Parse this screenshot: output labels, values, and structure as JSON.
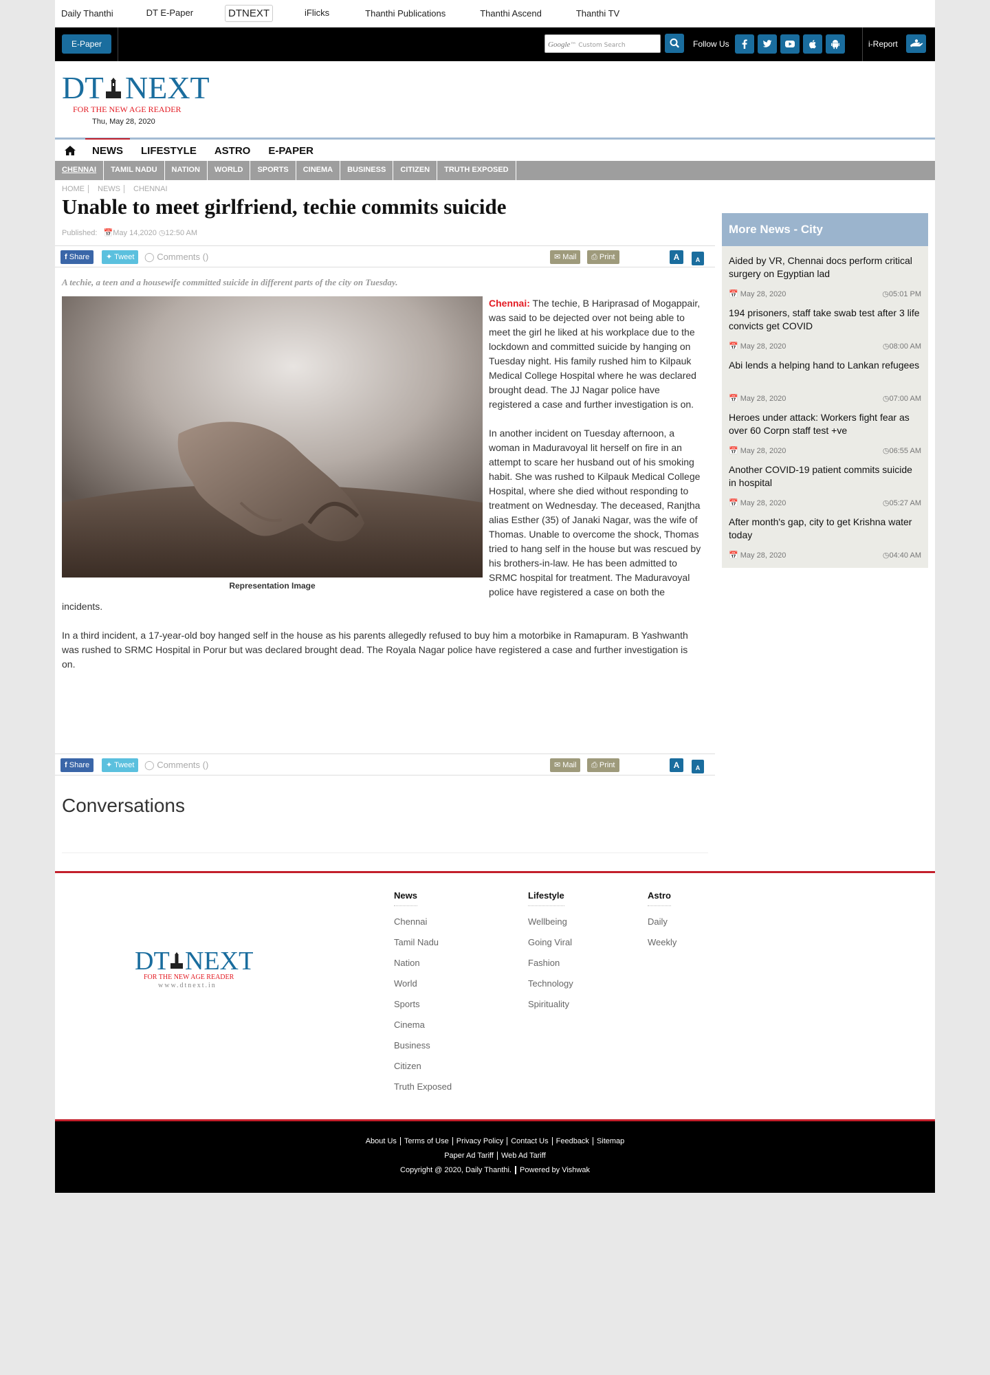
{
  "network": [
    "Daily Thanthi",
    "DT E-Paper",
    "DTNEXT",
    "iFlicks",
    "Thanthi Publications",
    "Thanthi Ascend",
    "Thanthi TV"
  ],
  "blackbar": {
    "epaper_label": "E-Paper",
    "search_placeholder": "Custom Search",
    "search_brand": "Google",
    "follow_label": "Follow Us",
    "ireport_label": "i-Report"
  },
  "masthead": {
    "logo_text": "DT NEXT",
    "tagline": "FOR THE NEW AGE READER",
    "date": "Thu, May 28, 2020"
  },
  "mainnav": [
    "NEWS",
    "LIFESTYLE",
    "ASTRO",
    "E-PAPER"
  ],
  "subnav": [
    "CHENNAI",
    "TAMIL NADU",
    "NATION",
    "WORLD",
    "SPORTS",
    "CINEMA",
    "BUSINESS",
    "CITIZEN",
    "TRUTH EXPOSED"
  ],
  "breadcrumb": [
    "HOME",
    "NEWS",
    "CHENNAI"
  ],
  "article": {
    "title": "Unable to meet girlfriend, techie commits suicide",
    "published_label": "Published:",
    "date": "May 14,2020",
    "time": "12:50 AM",
    "summary": "A techie, a teen and a housewife committed suicide in different parts of the city on Tuesday.",
    "caption": "Representation Image",
    "location": "Chennai:",
    "p1": "The techie, B Hariprasad of Mogappair, was said to be dejected over not being able to meet the girl he liked at his workplace due to the lockdown and committed suicide by hanging on Tuesday night. His family rushed him to Kilpauk Medical College Hospital where he was declared brought dead. The JJ Nagar police have registered a case and further investigation is on.",
    "p2": "In another incident on Tuesday afternoon, a woman in Maduravoyal lit herself on fire in an attempt to scare her husband out of his smoking habit. She was rushed to Kilpauk Medical College Hospital, where she died without responding to treatment on Wednesday. The deceased, Ranjtha alias Esther (35) of Janaki Nagar, was the wife of Thomas. Unable to overcome the shock, Thomas tried to hang self in the house but was rescued by his brothers-in-law. He has been admitted to SRMC hospital for treatment. The Maduravoyal police have registered a case on both the incidents.",
    "p3": "In a third incident, a 17-year-old boy hanged self in the house as his parents allegedly refused to buy him a motorbike in Ramapuram. B Yashwanth was rushed to SRMC Hospital in Porur but was declared brought dead. The Royala Nagar police have registered a case and further investigation is on."
  },
  "sharebar": {
    "share": "Share",
    "tweet": "Tweet",
    "comments": "Comments ()",
    "mail": "Mail",
    "print": "Print",
    "font_large": "A",
    "font_small": "A"
  },
  "conversations": "Conversations",
  "sidebar": {
    "title": "More News - City",
    "items": [
      {
        "headline": "Aided by VR, Chennai docs perform critical surgery on Egyptian lad",
        "date": "May 28, 2020",
        "time": "05:01 PM"
      },
      {
        "headline": "194 prisoners, staff take swab test after 3 life convicts get COVID",
        "date": "May 28, 2020",
        "time": "08:00 AM"
      },
      {
        "headline": "Abi lends a helping hand to Lankan refugees",
        "date": "May 28, 2020",
        "time": "07:00 AM"
      },
      {
        "headline": "Heroes under attack: Workers fight fear as over 60 Corpn staff test +ve",
        "date": "May 28, 2020",
        "time": "06:55 AM"
      },
      {
        "headline": "Another COVID-19 patient commits suicide in hospital",
        "date": "May 28, 2020",
        "time": "05:27 AM"
      },
      {
        "headline": "After month's gap, city to get Krishna water today",
        "date": "May 28, 2020",
        "time": "04:40 AM"
      }
    ]
  },
  "footer": {
    "logo_url_text": "www.dtnext.in",
    "news_head": "News",
    "news": [
      "Chennai",
      "Tamil Nadu",
      "Nation",
      "World",
      "Sports",
      "Cinema",
      "Business",
      "Citizen",
      "Truth Exposed"
    ],
    "lifestyle_head": "Lifestyle",
    "lifestyle": [
      "Wellbeing",
      "Going Viral",
      "Fashion",
      "Technology",
      "Spirituality"
    ],
    "astro_head": "Astro",
    "astro": [
      "Daily",
      "Weekly"
    ],
    "links1": [
      "About Us",
      "Terms of Use",
      "Privacy Policy",
      "Contact Us",
      "Feedback",
      "Sitemap"
    ],
    "links2": [
      "Paper Ad Tariff",
      "Web Ad Tariff"
    ],
    "copyright": "Copyright @ 2020, Daily Thanthi.",
    "powered": "Powered by Vishwak"
  }
}
